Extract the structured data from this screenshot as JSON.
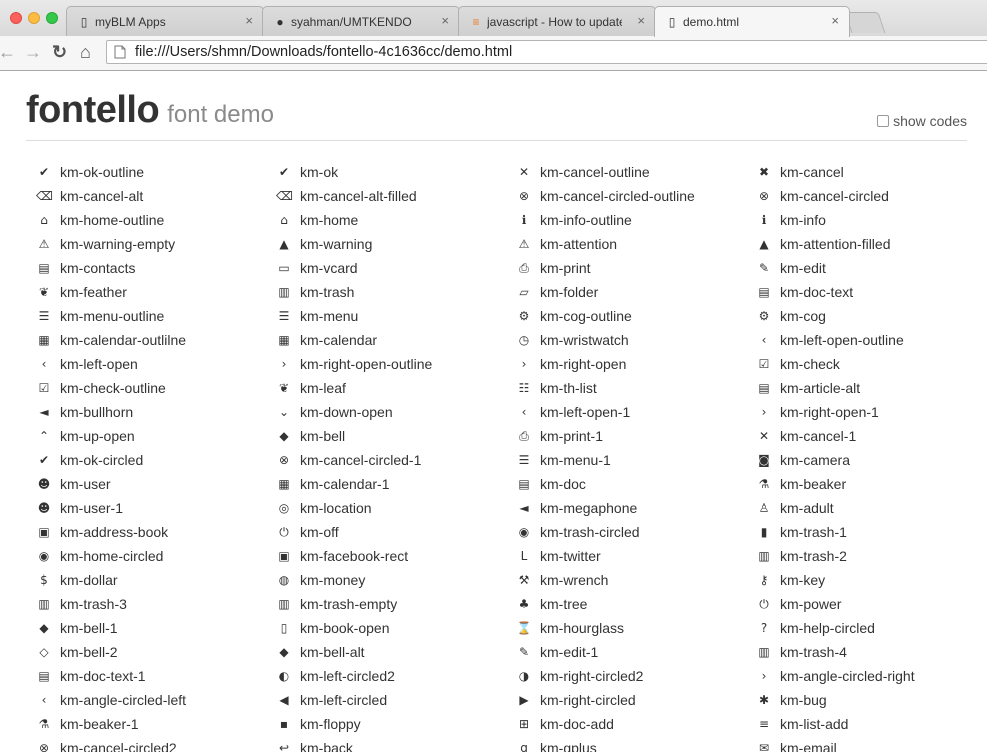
{
  "browser": {
    "tabs": [
      {
        "title": "myBLM Apps",
        "icon": "page-icon",
        "glyph": "▯",
        "active": false
      },
      {
        "title": "syahman/UMTKENDO",
        "icon": "github-icon",
        "glyph": "●",
        "active": false
      },
      {
        "title": "javascript - How to update",
        "icon": "stackoverflow-icon",
        "glyph": "≡",
        "active": false
      },
      {
        "title": "demo.html",
        "icon": "page-icon",
        "glyph": "▯",
        "active": true
      }
    ],
    "tab_close": "×",
    "url": "file:///Users/shmn/Downloads/fontello-4c1636cc/demo.html"
  },
  "page": {
    "logo": "fontello",
    "subtitle": "font demo",
    "show_codes": "show codes"
  },
  "icons": [
    {
      "name": "km-ok-outline",
      "glyph": "✔"
    },
    {
      "name": "km-ok",
      "glyph": "✔"
    },
    {
      "name": "km-cancel-outline",
      "glyph": "✕"
    },
    {
      "name": "km-cancel",
      "glyph": "✖"
    },
    {
      "name": "km-cancel-alt",
      "glyph": "⌫"
    },
    {
      "name": "km-cancel-alt-filled",
      "glyph": "⌫"
    },
    {
      "name": "km-cancel-circled-outline",
      "glyph": "⊗"
    },
    {
      "name": "km-cancel-circled",
      "glyph": "⊗"
    },
    {
      "name": "km-home-outline",
      "glyph": "⌂"
    },
    {
      "name": "km-home",
      "glyph": "⌂"
    },
    {
      "name": "km-info-outline",
      "glyph": "ℹ"
    },
    {
      "name": "km-info",
      "glyph": "ℹ"
    },
    {
      "name": "km-warning-empty",
      "glyph": "⚠"
    },
    {
      "name": "km-warning",
      "glyph": "▲"
    },
    {
      "name": "km-attention",
      "glyph": "⚠"
    },
    {
      "name": "km-attention-filled",
      "glyph": "▲"
    },
    {
      "name": "km-contacts",
      "glyph": "▤"
    },
    {
      "name": "km-vcard",
      "glyph": "▭"
    },
    {
      "name": "km-print",
      "glyph": "⎙"
    },
    {
      "name": "km-edit",
      "glyph": "✎"
    },
    {
      "name": "km-feather",
      "glyph": "❦"
    },
    {
      "name": "km-trash",
      "glyph": "▥"
    },
    {
      "name": "km-folder",
      "glyph": "▱"
    },
    {
      "name": "km-doc-text",
      "glyph": "▤"
    },
    {
      "name": "km-menu-outline",
      "glyph": "☰"
    },
    {
      "name": "km-menu",
      "glyph": "☰"
    },
    {
      "name": "km-cog-outline",
      "glyph": "⚙"
    },
    {
      "name": "km-cog",
      "glyph": "⚙"
    },
    {
      "name": "km-calendar-outlilne",
      "glyph": "▦"
    },
    {
      "name": "km-calendar",
      "glyph": "▦"
    },
    {
      "name": "km-wristwatch",
      "glyph": "◷"
    },
    {
      "name": "km-left-open-outline",
      "glyph": "‹"
    },
    {
      "name": "km-left-open",
      "glyph": "‹"
    },
    {
      "name": "km-right-open-outline",
      "glyph": "›"
    },
    {
      "name": "km-right-open",
      "glyph": "›"
    },
    {
      "name": "km-check",
      "glyph": "☑"
    },
    {
      "name": "km-check-outline",
      "glyph": "☑"
    },
    {
      "name": "km-leaf",
      "glyph": "❦"
    },
    {
      "name": "km-th-list",
      "glyph": "☷"
    },
    {
      "name": "km-article-alt",
      "glyph": "▤"
    },
    {
      "name": "km-bullhorn",
      "glyph": "◄"
    },
    {
      "name": "km-down-open",
      "glyph": "⌄"
    },
    {
      "name": "km-left-open-1",
      "glyph": "‹"
    },
    {
      "name": "km-right-open-1",
      "glyph": "›"
    },
    {
      "name": "km-up-open",
      "glyph": "⌃"
    },
    {
      "name": "km-bell",
      "glyph": "◆"
    },
    {
      "name": "km-print-1",
      "glyph": "⎙"
    },
    {
      "name": "km-cancel-1",
      "glyph": "✕"
    },
    {
      "name": "km-ok-circled",
      "glyph": "✔"
    },
    {
      "name": "km-cancel-circled-1",
      "glyph": "⊗"
    },
    {
      "name": "km-menu-1",
      "glyph": "☰"
    },
    {
      "name": "km-camera",
      "glyph": "◙"
    },
    {
      "name": "km-user",
      "glyph": "☻"
    },
    {
      "name": "km-calendar-1",
      "glyph": "▦"
    },
    {
      "name": "km-doc",
      "glyph": "▤"
    },
    {
      "name": "km-beaker",
      "glyph": "⚗"
    },
    {
      "name": "km-user-1",
      "glyph": "☻"
    },
    {
      "name": "km-location",
      "glyph": "◎"
    },
    {
      "name": "km-megaphone",
      "glyph": "◄"
    },
    {
      "name": "km-adult",
      "glyph": "♙"
    },
    {
      "name": "km-address-book",
      "glyph": "▣"
    },
    {
      "name": "km-off",
      "glyph": "⏻"
    },
    {
      "name": "km-trash-circled",
      "glyph": "◉"
    },
    {
      "name": "km-trash-1",
      "glyph": "▮"
    },
    {
      "name": "km-home-circled",
      "glyph": "◉"
    },
    {
      "name": "km-facebook-rect",
      "glyph": "▣"
    },
    {
      "name": "km-twitter",
      "glyph": "ᒪ"
    },
    {
      "name": "km-trash-2",
      "glyph": "▥"
    },
    {
      "name": "km-dollar",
      "glyph": "$"
    },
    {
      "name": "km-money",
      "glyph": "◍"
    },
    {
      "name": "km-wrench",
      "glyph": "⚒"
    },
    {
      "name": "km-key",
      "glyph": "⚷"
    },
    {
      "name": "km-trash-3",
      "glyph": "▥"
    },
    {
      "name": "km-trash-empty",
      "glyph": "▥"
    },
    {
      "name": "km-tree",
      "glyph": "♣"
    },
    {
      "name": "km-power",
      "glyph": "⏻"
    },
    {
      "name": "km-bell-1",
      "glyph": "◆"
    },
    {
      "name": "km-book-open",
      "glyph": "▯"
    },
    {
      "name": "km-hourglass",
      "glyph": "⌛"
    },
    {
      "name": "km-help-circled",
      "glyph": "?"
    },
    {
      "name": "km-bell-2",
      "glyph": "◇"
    },
    {
      "name": "km-bell-alt",
      "glyph": "◆"
    },
    {
      "name": "km-edit-1",
      "glyph": "✎"
    },
    {
      "name": "km-trash-4",
      "glyph": "▥"
    },
    {
      "name": "km-doc-text-1",
      "glyph": "▤"
    },
    {
      "name": "km-left-circled2",
      "glyph": "◐"
    },
    {
      "name": "km-right-circled2",
      "glyph": "◑"
    },
    {
      "name": "km-angle-circled-right",
      "glyph": "›"
    },
    {
      "name": "km-angle-circled-left",
      "glyph": "‹"
    },
    {
      "name": "km-left-circled",
      "glyph": "◀"
    },
    {
      "name": "km-right-circled",
      "glyph": "▶"
    },
    {
      "name": "km-bug",
      "glyph": "✱"
    },
    {
      "name": "km-beaker-1",
      "glyph": "⚗"
    },
    {
      "name": "km-floppy",
      "glyph": "▪"
    },
    {
      "name": "km-doc-add",
      "glyph": "⊞"
    },
    {
      "name": "km-list-add",
      "glyph": "≡"
    },
    {
      "name": "km-cancel-circled2",
      "glyph": "⊗"
    },
    {
      "name": "km-back",
      "glyph": "↩"
    },
    {
      "name": "km-gplus",
      "glyph": "g"
    },
    {
      "name": "km-email",
      "glyph": "✉"
    }
  ]
}
